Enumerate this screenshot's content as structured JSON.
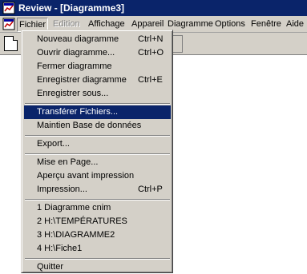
{
  "window": {
    "title": "Review - [Diagramme3]"
  },
  "menubar": {
    "items": [
      {
        "label": "Fichier"
      },
      {
        "label": "Edition"
      },
      {
        "label": "Affichage"
      },
      {
        "label": "Appareil"
      },
      {
        "label": "Diagramme"
      },
      {
        "label": "Options"
      },
      {
        "label": "Fenêtre"
      },
      {
        "label": "Aide"
      }
    ]
  },
  "file_menu": {
    "items": [
      {
        "label": "Nouveau diagramme",
        "shortcut": "Ctrl+N"
      },
      {
        "label": "Ouvrir diagramme...",
        "shortcut": "Ctrl+O"
      },
      {
        "label": "Fermer diagramme",
        "shortcut": ""
      },
      {
        "label": "Enregistrer diagramme",
        "shortcut": "Ctrl+E"
      },
      {
        "label": "Enregistrer sous...",
        "shortcut": ""
      },
      {
        "label": "Transférer Fichiers...",
        "shortcut": "",
        "highlighted": true
      },
      {
        "label": "Maintien Base de données",
        "shortcut": ""
      },
      {
        "label": "Export...",
        "shortcut": ""
      },
      {
        "label": "Mise en Page...",
        "shortcut": ""
      },
      {
        "label": "Aperçu avant impression",
        "shortcut": ""
      },
      {
        "label": "Impression...",
        "shortcut": "Ctrl+P"
      },
      {
        "label": "1 Diagramme cnim",
        "shortcut": ""
      },
      {
        "label": "2 H:\\TEMPÉRATURES",
        "shortcut": ""
      },
      {
        "label": "3 H:\\DIAGRAMME2",
        "shortcut": ""
      },
      {
        "label": "4 H:\\Fiche1",
        "shortcut": ""
      },
      {
        "label": "Quitter",
        "shortcut": ""
      }
    ]
  },
  "icons": {
    "app": "review-app-icon",
    "document": "document-icon",
    "new_document": "new-document-icon"
  },
  "colors": {
    "titlebar": "#0a246a",
    "highlight": "#0a246a",
    "menu_face": "#d4d0c8"
  }
}
